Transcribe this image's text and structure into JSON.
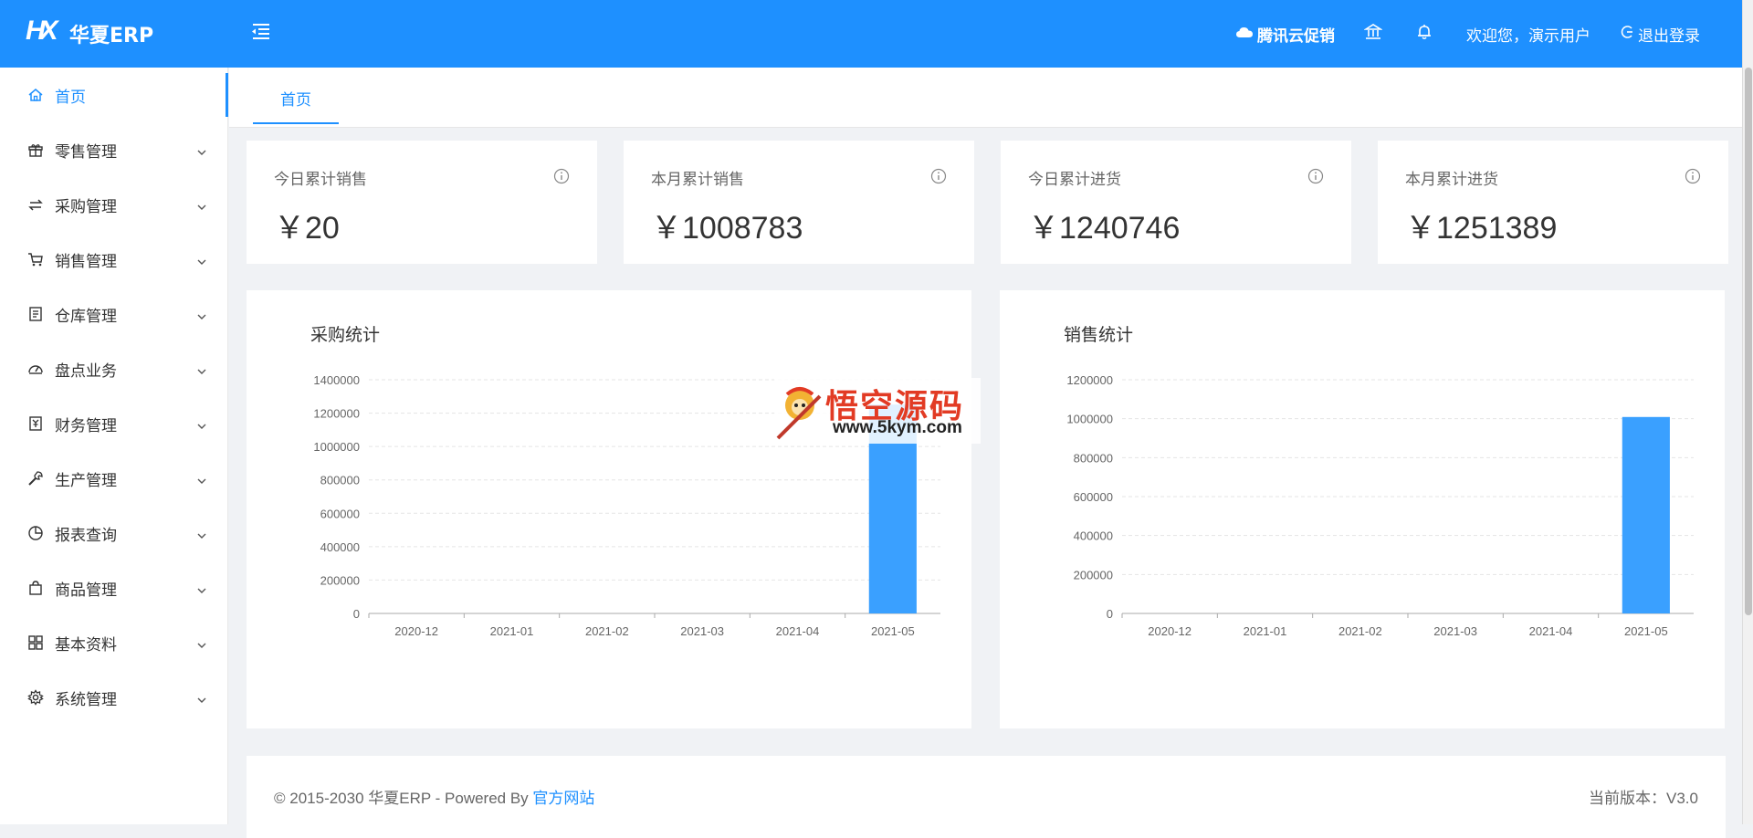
{
  "header": {
    "brand": "华夏ERP",
    "logo_text": "HX",
    "promo": "腾讯云促销",
    "welcome": "欢迎您，演示用户",
    "logout": "退出登录"
  },
  "sidebar": {
    "items": [
      {
        "label": "首页",
        "icon": "home-icon"
      },
      {
        "label": "零售管理",
        "icon": "gift-icon"
      },
      {
        "label": "采购管理",
        "icon": "swap-icon"
      },
      {
        "label": "销售管理",
        "icon": "cart-icon"
      },
      {
        "label": "仓库管理",
        "icon": "book-icon"
      },
      {
        "label": "盘点业务",
        "icon": "dashboard-icon"
      },
      {
        "label": "财务管理",
        "icon": "account-book-icon"
      },
      {
        "label": "生产管理",
        "icon": "tool-icon"
      },
      {
        "label": "报表查询",
        "icon": "pie-chart-icon"
      },
      {
        "label": "商品管理",
        "icon": "shopping-icon"
      },
      {
        "label": "基本资料",
        "icon": "appstore-icon"
      },
      {
        "label": "系统管理",
        "icon": "setting-icon"
      }
    ]
  },
  "tabs": [
    {
      "label": "首页"
    }
  ],
  "stats": [
    {
      "title": "今日累计销售",
      "value": "￥20"
    },
    {
      "title": "本月累计销售",
      "value": "￥1008783"
    },
    {
      "title": "今日累计进货",
      "value": "￥1240746"
    },
    {
      "title": "本月累计进货",
      "value": "￥1251389"
    }
  ],
  "chart_data": [
    {
      "type": "bar",
      "title": "采购统计",
      "categories": [
        "2020-12",
        "2021-01",
        "2021-02",
        "2021-03",
        "2021-04",
        "2021-05"
      ],
      "values": [
        0,
        0,
        0,
        0,
        0,
        1251389
      ],
      "ylim": [
        0,
        1400000
      ],
      "yticks": [
        0,
        200000,
        400000,
        600000,
        800000,
        1000000,
        1200000,
        1400000
      ],
      "grid": true,
      "color": "#3aa0ff"
    },
    {
      "type": "bar",
      "title": "销售统计",
      "categories": [
        "2020-12",
        "2021-01",
        "2021-02",
        "2021-03",
        "2021-04",
        "2021-05"
      ],
      "values": [
        0,
        0,
        0,
        0,
        0,
        1008783
      ],
      "ylim": [
        0,
        1200000
      ],
      "yticks": [
        0,
        200000,
        400000,
        600000,
        800000,
        1000000,
        1200000
      ],
      "grid": true,
      "color": "#3aa0ff"
    }
  ],
  "footer": {
    "copyright": "© 2015-2030 华夏ERP - Powered By ",
    "link": "官方网站",
    "version": "当前版本：V3.0"
  },
  "watermark": {
    "cn": "悟空源码",
    "url": "www.5kym.com"
  },
  "colors": {
    "primary": "#1e90ff",
    "bar": "#3aa0ff"
  }
}
